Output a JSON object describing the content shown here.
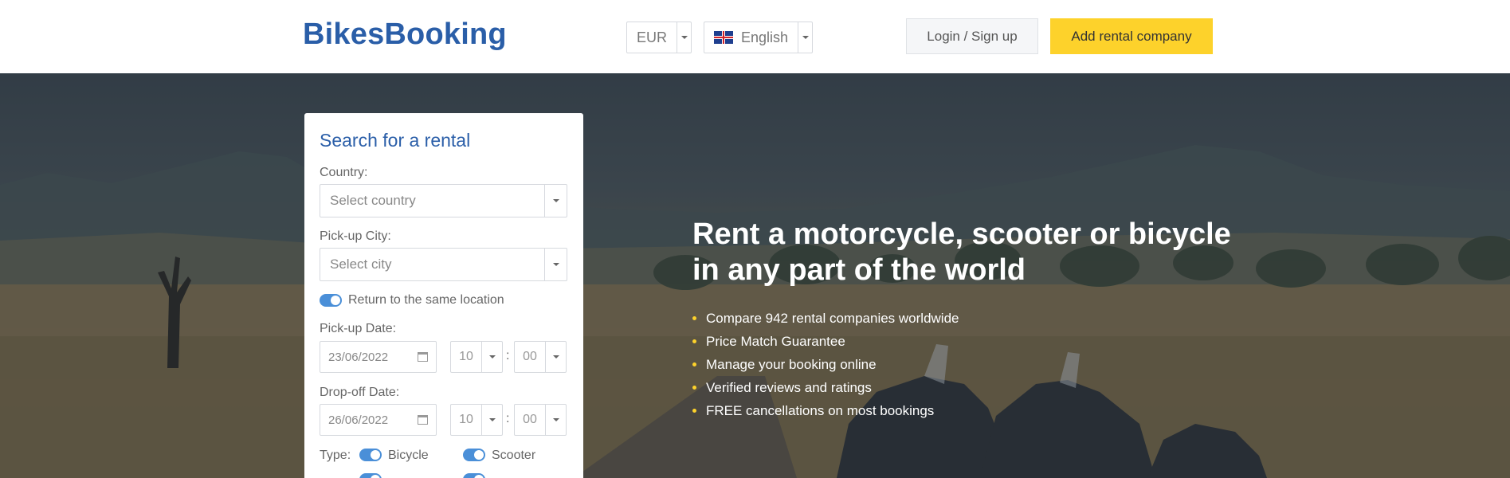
{
  "header": {
    "logo": "BikesBooking",
    "currency": "EUR",
    "language": "English",
    "login_label": "Login / Sign up",
    "add_company_label": "Add rental company",
    "accent_color": "#fdd22b",
    "brand_color": "#2a5ea8"
  },
  "hero": {
    "headline_line1": "Rent a motorcycle, scooter or bicycle",
    "headline_line2": "in any part of the world",
    "bullets": [
      "Compare 942 rental companies worldwide",
      "Price Match Guarantee",
      "Manage your booking online",
      "Verified reviews and ratings",
      "FREE cancellations on most bookings"
    ]
  },
  "search": {
    "title": "Search for a rental",
    "country_label": "Country:",
    "country_placeholder": "Select country",
    "city_label": "Pick-up City:",
    "city_placeholder": "Select city",
    "same_location_label": "Return to the same location",
    "pickup_label": "Pick-up Date:",
    "pickup_date": "23/06/2022",
    "pickup_hour": "10",
    "pickup_minute": "00",
    "dropoff_label": "Drop-off Date:",
    "dropoff_date": "26/06/2022",
    "dropoff_hour": "10",
    "dropoff_minute": "00",
    "type_label": "Type:",
    "type_bicycle": "Bicycle",
    "type_scooter": "Scooter"
  }
}
